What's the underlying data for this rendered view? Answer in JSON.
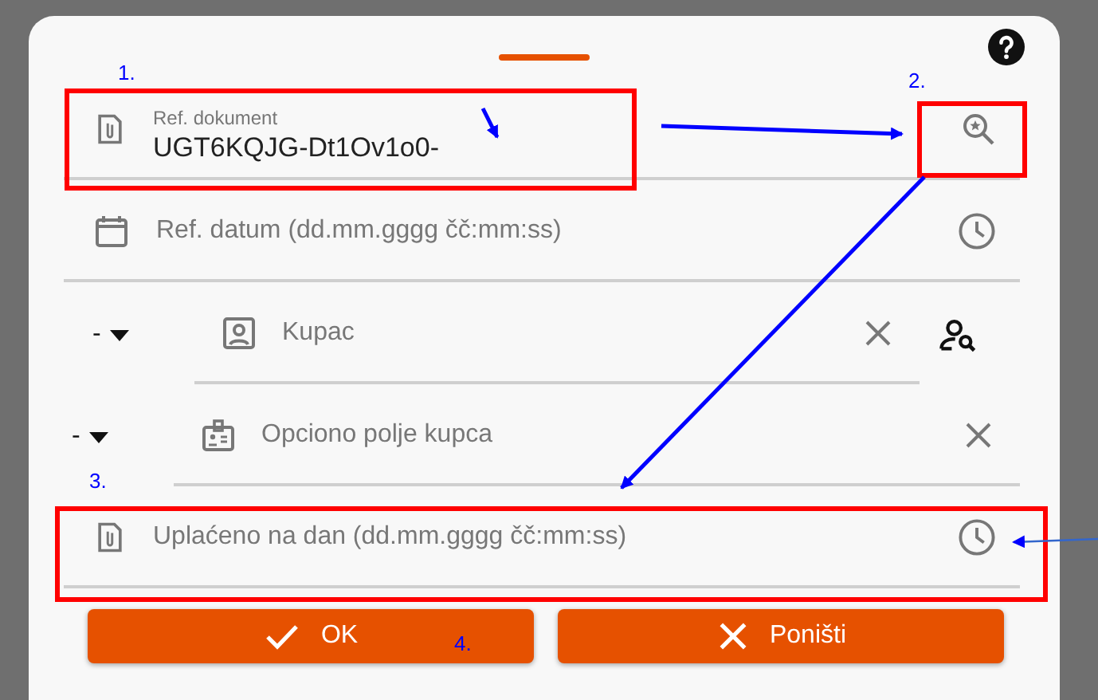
{
  "sheet": {
    "fields": [
      {
        "kind": "document",
        "label": "Ref. dokument",
        "value": "UGT6KQJG-Dt1Ov1o0-"
      },
      {
        "kind": "date",
        "placeholder": "Ref. datum (dd.mm.gggg čč:mm:ss)"
      },
      {
        "kind": "customer",
        "prefix": "-",
        "placeholder": "Kupac"
      },
      {
        "kind": "customer-field",
        "prefix": "-",
        "placeholder": "Opciono polje kupca"
      },
      {
        "kind": "payment-date",
        "placeholder": "Uplaćeno na dan (dd.mm.gggg čč:mm:ss)"
      }
    ],
    "buttons": [
      {
        "kind": "ok",
        "label": "OK"
      },
      {
        "kind": "cancel",
        "label": "Poništi"
      }
    ]
  },
  "annotations": {
    "step_numbers": [
      "1.",
      "2.",
      "3.",
      "4."
    ]
  }
}
